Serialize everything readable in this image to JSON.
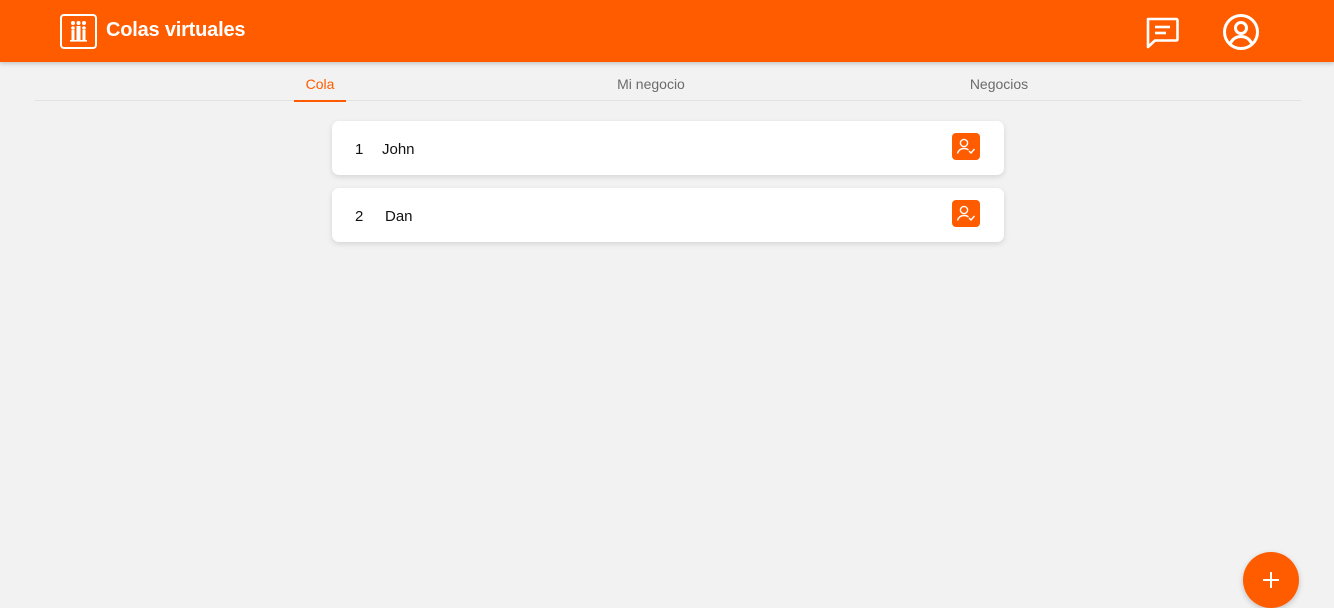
{
  "header": {
    "title": "Colas virtuales",
    "logo_icon": "people-queue-icon",
    "chat_icon": "chat-message-icon",
    "account_icon": "account-circle-icon",
    "background": "#ff5c00"
  },
  "tabs": [
    {
      "label": "Cola",
      "active": true
    },
    {
      "label": "Mi negocio",
      "active": false
    },
    {
      "label": "Negocios",
      "active": false
    }
  ],
  "queue": [
    {
      "position": "1",
      "name": "John",
      "action_icon": "person-check-icon"
    },
    {
      "position": "2",
      "name": "Dan",
      "action_icon": "person-check-icon"
    }
  ],
  "fab": {
    "icon": "plus-icon"
  },
  "colors": {
    "accent": "#ff5c00",
    "background": "#f2f2f2",
    "card": "#ffffff"
  }
}
